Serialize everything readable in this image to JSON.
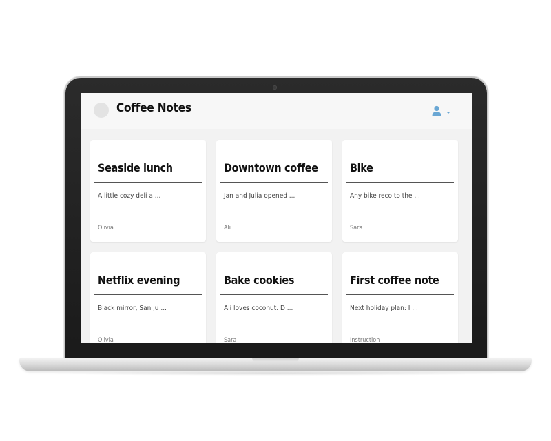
{
  "app": {
    "title": "Coffee Notes"
  },
  "header": {
    "user_icon": "user-icon",
    "menu_icon": "chevron-down-icon",
    "accent_color": "#6aa7d4"
  },
  "notes": [
    {
      "title": "Seaside lunch",
      "excerpt": "A little cozy deli a ...",
      "author": "Olivia"
    },
    {
      "title": "Downtown coffee",
      "excerpt": "Jan and Julia opened ...",
      "author": "Ali"
    },
    {
      "title": "Bike",
      "excerpt": "Any bike reco to the ...",
      "author": "Sara"
    },
    {
      "title": "Netflix evening",
      "excerpt": "Black mirror, San Ju ...",
      "author": "Olivia"
    },
    {
      "title": "Bake cookies",
      "excerpt": "Ali loves coconut. D ...",
      "author": "Sara"
    },
    {
      "title": "First coffee note",
      "excerpt": "Next holiday plan: I ...",
      "author": "Instruction"
    }
  ]
}
